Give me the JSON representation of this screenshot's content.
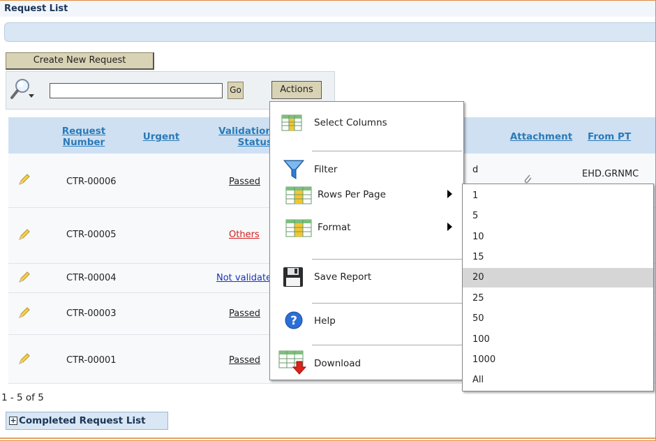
{
  "region": {
    "title": "Request List"
  },
  "toolbar": {
    "create_label": "Create New Request",
    "search_value": "",
    "go_label": "Go",
    "actions_label": "Actions"
  },
  "table": {
    "headers": {
      "request_number": "Request Number",
      "urgent": "Urgent",
      "validation_status": "Validation Status",
      "attachment": "Attachment",
      "from_pt": "From PT"
    },
    "rows": [
      {
        "number": "CTR-00006",
        "status": "Passed",
        "status_color": "#222222",
        "from_pt": "EHD.GRNMC"
      },
      {
        "number": "CTR-00005",
        "status": "Others",
        "status_color": "#d21d1d",
        "from_pt": ""
      },
      {
        "number": "CTR-00004",
        "status": "Not validated",
        "status_color": "#1a34b8",
        "from_pt": ""
      },
      {
        "number": "CTR-00003",
        "status": "Passed",
        "status_color": "#222222",
        "from_pt": ""
      },
      {
        "number": "CTR-00001",
        "status": "Passed",
        "status_color": "#222222",
        "from_pt": ""
      }
    ]
  },
  "pagination": {
    "text": "1 - 5 of 5"
  },
  "completed": {
    "label": "Completed Request List"
  },
  "actions_menu": {
    "select_columns": "Select Columns",
    "filter": "Filter",
    "rows_per_page": "Rows Per Page",
    "format": "Format",
    "save_report": "Save Report",
    "help": "Help",
    "download": "Download"
  },
  "rows_per_page_menu": {
    "options": [
      "1",
      "5",
      "10",
      "15",
      "20",
      "25",
      "50",
      "100",
      "1000",
      "All"
    ],
    "selected": "20"
  }
}
